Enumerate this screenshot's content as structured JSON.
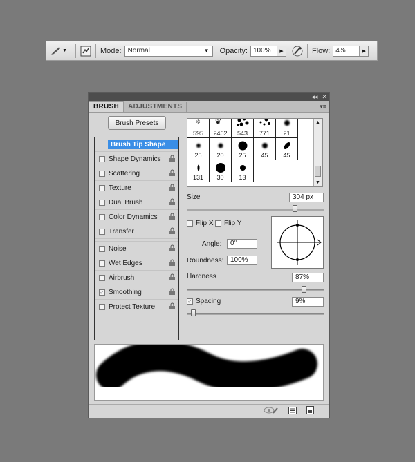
{
  "options_bar": {
    "brush_tool_icon": "brush-icon",
    "mode_label": "Mode:",
    "mode_value": "Normal",
    "opacity_label": "Opacity:",
    "opacity_value": "100%",
    "airbrush_icon": "airbrush-icon",
    "flow_label": "Flow:",
    "flow_value": "4%"
  },
  "panel": {
    "tabs": [
      {
        "label": "BRUSH",
        "active": true
      },
      {
        "label": "ADJUSTMENTS",
        "active": false
      }
    ],
    "brush_presets_label": "Brush Presets",
    "options": [
      {
        "label": "Brush Tip Shape",
        "selected": true,
        "checked": false
      },
      {
        "label": "Shape Dynamics",
        "checked": false
      },
      {
        "label": "Scattering",
        "checked": false
      },
      {
        "label": "Texture",
        "checked": false
      },
      {
        "label": "Dual Brush",
        "checked": false
      },
      {
        "label": "Color Dynamics",
        "checked": false
      },
      {
        "label": "Transfer",
        "checked": false
      },
      {
        "label": "Noise",
        "checked": false
      },
      {
        "label": "Wet Edges",
        "checked": false
      },
      {
        "label": "Airbrush",
        "checked": false
      },
      {
        "label": "Smoothing",
        "checked": true
      },
      {
        "label": "Protect Texture",
        "checked": false
      }
    ],
    "brush_grid": [
      {
        "num": "595"
      },
      {
        "num": "2462"
      },
      {
        "num": "543"
      },
      {
        "num": "771"
      },
      {
        "num": "21"
      },
      {
        "num": "25"
      },
      {
        "num": "20"
      },
      {
        "num": "25"
      },
      {
        "num": "45"
      },
      {
        "num": "45"
      },
      {
        "num": "131"
      },
      {
        "num": "30"
      },
      {
        "num": "13"
      }
    ],
    "size_label": "Size",
    "size_value": "304 px",
    "size_fraction": 0.8,
    "flip_x_label": "Flip X",
    "flip_y_label": "Flip Y",
    "angle_label": "Angle:",
    "angle_value": "0°",
    "roundness_label": "Roundness:",
    "roundness_value": "100%",
    "hardness_label": "Hardness",
    "hardness_value": "87%",
    "hardness_fraction": 0.87,
    "spacing_label": "Spacing",
    "spacing_checked": true,
    "spacing_value": "9%",
    "spacing_fraction": 0.03
  }
}
